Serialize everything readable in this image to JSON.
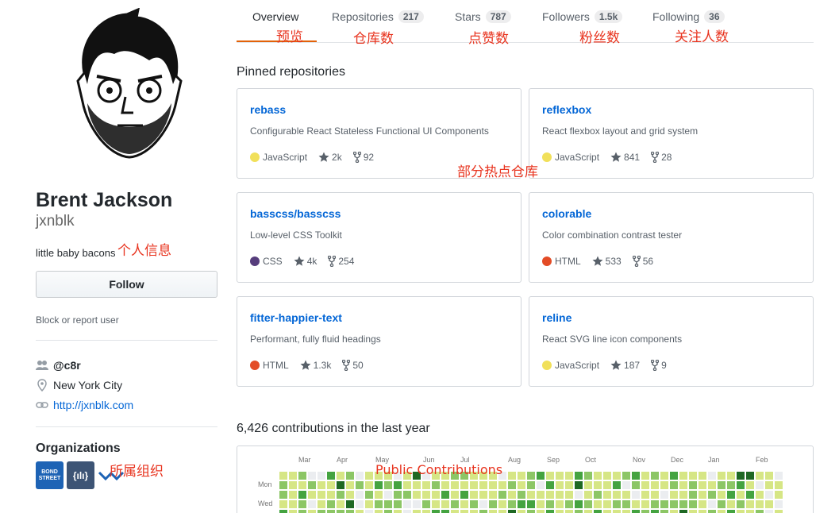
{
  "profile": {
    "full_name": "Brent Jackson",
    "login": "jxnblk",
    "bio": "little baby bacons",
    "follow_label": "Follow",
    "block_label": "Block or report user",
    "org_handle": "@c8r",
    "location": "New York City",
    "website": "http://jxnblk.com",
    "organizations_title": "Organizations",
    "orgs": [
      {
        "name": "BOND STREET",
        "icon": "bond-street-logo",
        "color": "#1d63b5"
      },
      {
        "name": "{ılı}",
        "icon": "json-logo",
        "color": "#3d5475"
      },
      {
        "name": "wave",
        "icon": "wave-logo",
        "color": "#1d63b5"
      }
    ]
  },
  "tabs": [
    {
      "label": "Overview",
      "count": "",
      "selected": true
    },
    {
      "label": "Repositories",
      "count": "217",
      "selected": false
    },
    {
      "label": "Stars",
      "count": "787",
      "selected": false
    },
    {
      "label": "Followers",
      "count": "1.5k",
      "selected": false
    },
    {
      "label": "Following",
      "count": "36",
      "selected": false
    }
  ],
  "annotations": {
    "overview": "预览",
    "repositories": "仓库数",
    "stars": "点赞数",
    "followers": "粉丝数",
    "following": "关注人数",
    "pinned": "部分热点仓库",
    "profile": "个人信息",
    "orgs": "所属组织",
    "contrib": "Public Contributions"
  },
  "pinned_title": "Pinned repositories",
  "repos": [
    {
      "owner": "",
      "name": "rebass",
      "description": "Configurable React Stateless Functional UI Components",
      "language": "JavaScript",
      "lang_color": "#f1e05a",
      "stars": "2k",
      "forks": "92"
    },
    {
      "owner": "",
      "name": "reflexbox",
      "description": "React flexbox layout and grid system",
      "language": "JavaScript",
      "lang_color": "#f1e05a",
      "stars": "841",
      "forks": "28"
    },
    {
      "owner": "basscss/",
      "name": "basscss",
      "description": "Low-level CSS Toolkit",
      "language": "CSS",
      "lang_color": "#563d7c",
      "stars": "4k",
      "forks": "254"
    },
    {
      "owner": "",
      "name": "colorable",
      "description": "Color combination contrast tester",
      "language": "HTML",
      "lang_color": "#e34c26",
      "stars": "533",
      "forks": "56"
    },
    {
      "owner": "",
      "name": "fitter-happier-text",
      "description": "Performant, fully fluid headings",
      "language": "HTML",
      "lang_color": "#e34c26",
      "stars": "1.3k",
      "forks": "50"
    },
    {
      "owner": "",
      "name": "reline",
      "description": "React SVG line icon components",
      "language": "JavaScript",
      "lang_color": "#f1e05a",
      "stars": "187",
      "forks": "9"
    }
  ],
  "contributions": {
    "title": "6,426 contributions in the last year",
    "months": [
      "Mar",
      "Apr",
      "May",
      "Jun",
      "Jul",
      "Aug",
      "Sep",
      "Oct",
      "Nov",
      "Dec",
      "Jan",
      "Feb"
    ],
    "day_labels": [
      "Mon",
      "Wed"
    ],
    "palette": [
      "#ebedf0",
      "#d6e685",
      "#8cc665",
      "#44a340",
      "#1e6823"
    ]
  }
}
